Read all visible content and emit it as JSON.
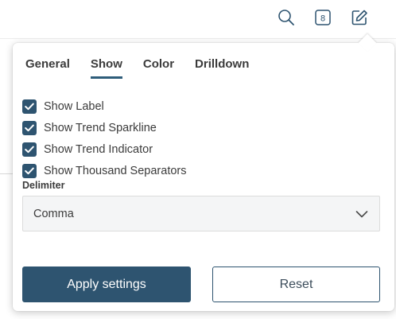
{
  "top_bar": {
    "icons": [
      "search-icon",
      "badge-8-icon",
      "edit-icon"
    ],
    "badge_number": "8"
  },
  "tabs": [
    {
      "label": "General",
      "active": false
    },
    {
      "label": "Show",
      "active": true
    },
    {
      "label": "Color",
      "active": false
    },
    {
      "label": "Drilldown",
      "active": false
    }
  ],
  "checkboxes": [
    {
      "label": "Show Label",
      "checked": true
    },
    {
      "label": "Show Trend Sparkline",
      "checked": true
    },
    {
      "label": "Show Trend Indicator",
      "checked": true
    },
    {
      "label": "Show Thousand Separators",
      "checked": true
    }
  ],
  "delimiter": {
    "label": "Delimiter",
    "value": "Comma"
  },
  "buttons": {
    "apply_label": "Apply settings",
    "reset_label": "Reset"
  },
  "colors": {
    "accent": "#2e5470",
    "tab_underline": "#2e5d7a"
  }
}
